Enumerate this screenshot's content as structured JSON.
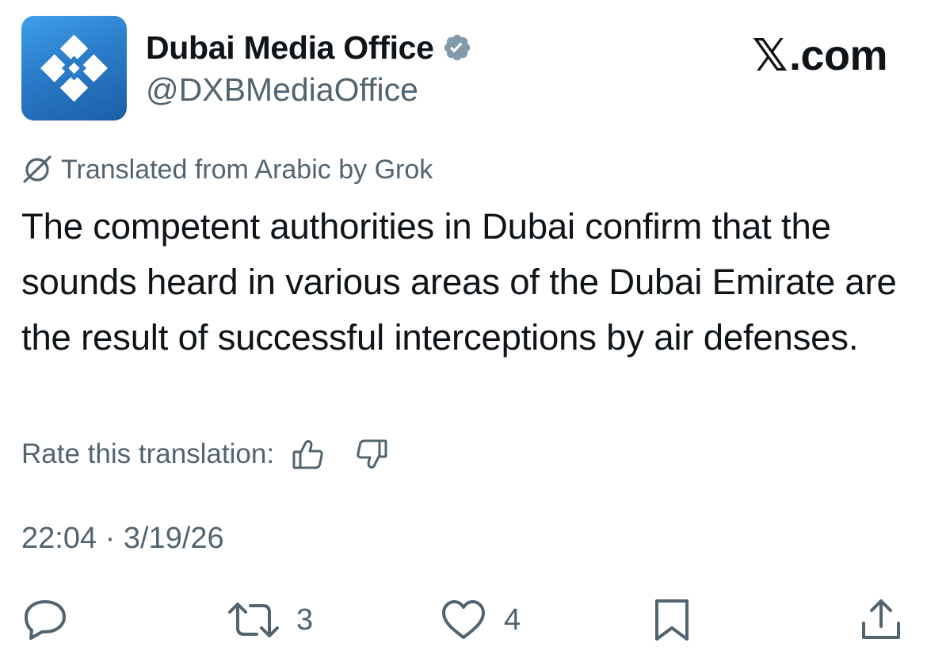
{
  "author": {
    "display_name": "Dubai Media Office",
    "handle": "@DXBMediaOffice",
    "verified": true,
    "avatar_colors": [
      "#3f9fe8",
      "#1c5ea8"
    ]
  },
  "brand": {
    "x_glyph": "𝕏",
    "suffix": ".com"
  },
  "translation": {
    "label": "Translated from Arabic by Grok",
    "icon": "grok-icon"
  },
  "tweet": {
    "text": "The competent authorities in Dubai confirm that the sounds heard in various areas of the Dubai Emirate are the result of successful interceptions by air defenses."
  },
  "rate": {
    "label": "Rate this translation:",
    "icons": [
      "thumbs-up-icon",
      "thumbs-down-icon"
    ]
  },
  "timestamp": "22:04 · 3/19/26",
  "actions": {
    "reply": {
      "icon": "reply-icon",
      "count": ""
    },
    "repost": {
      "icon": "repost-icon",
      "count": "3"
    },
    "like": {
      "icon": "heart-icon",
      "count": "4"
    },
    "bookmark": {
      "icon": "bookmark-icon",
      "count": ""
    },
    "share": {
      "icon": "share-icon",
      "count": ""
    }
  },
  "colors": {
    "text": "#0f1419",
    "secondary": "#536471",
    "verified_badge": "#829aab"
  }
}
